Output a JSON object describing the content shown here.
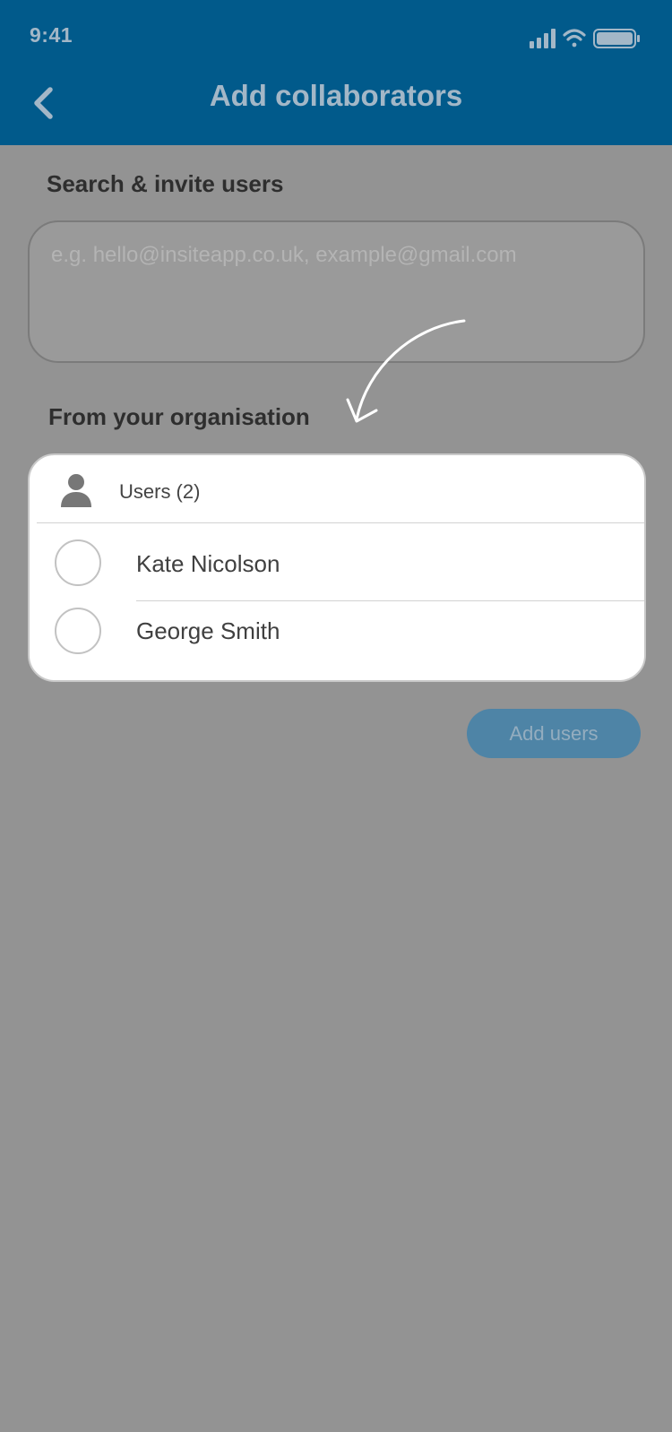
{
  "status_bar": {
    "time": "9:41",
    "signal_icon": "cellular-signal-icon",
    "wifi_icon": "wifi-icon",
    "battery_icon": "battery-icon"
  },
  "nav": {
    "title": "Add collaborators",
    "back_icon": "chevron-left-icon"
  },
  "search": {
    "label": "Search & invite users",
    "placeholder": "e.g. hello@insiteapp.co.uk, example@gmail.com"
  },
  "organisation": {
    "label": "From your organisation",
    "group_icon": "user-icon",
    "group_label": "Users (2)",
    "users": [
      {
        "name": "Kate Nicolson",
        "selected": false
      },
      {
        "name": "George Smith",
        "selected": false
      }
    ]
  },
  "actions": {
    "add_label": "Add users"
  },
  "colors": {
    "header": "#015a8b",
    "overlay": "#939393",
    "button": "#4e84a6"
  }
}
